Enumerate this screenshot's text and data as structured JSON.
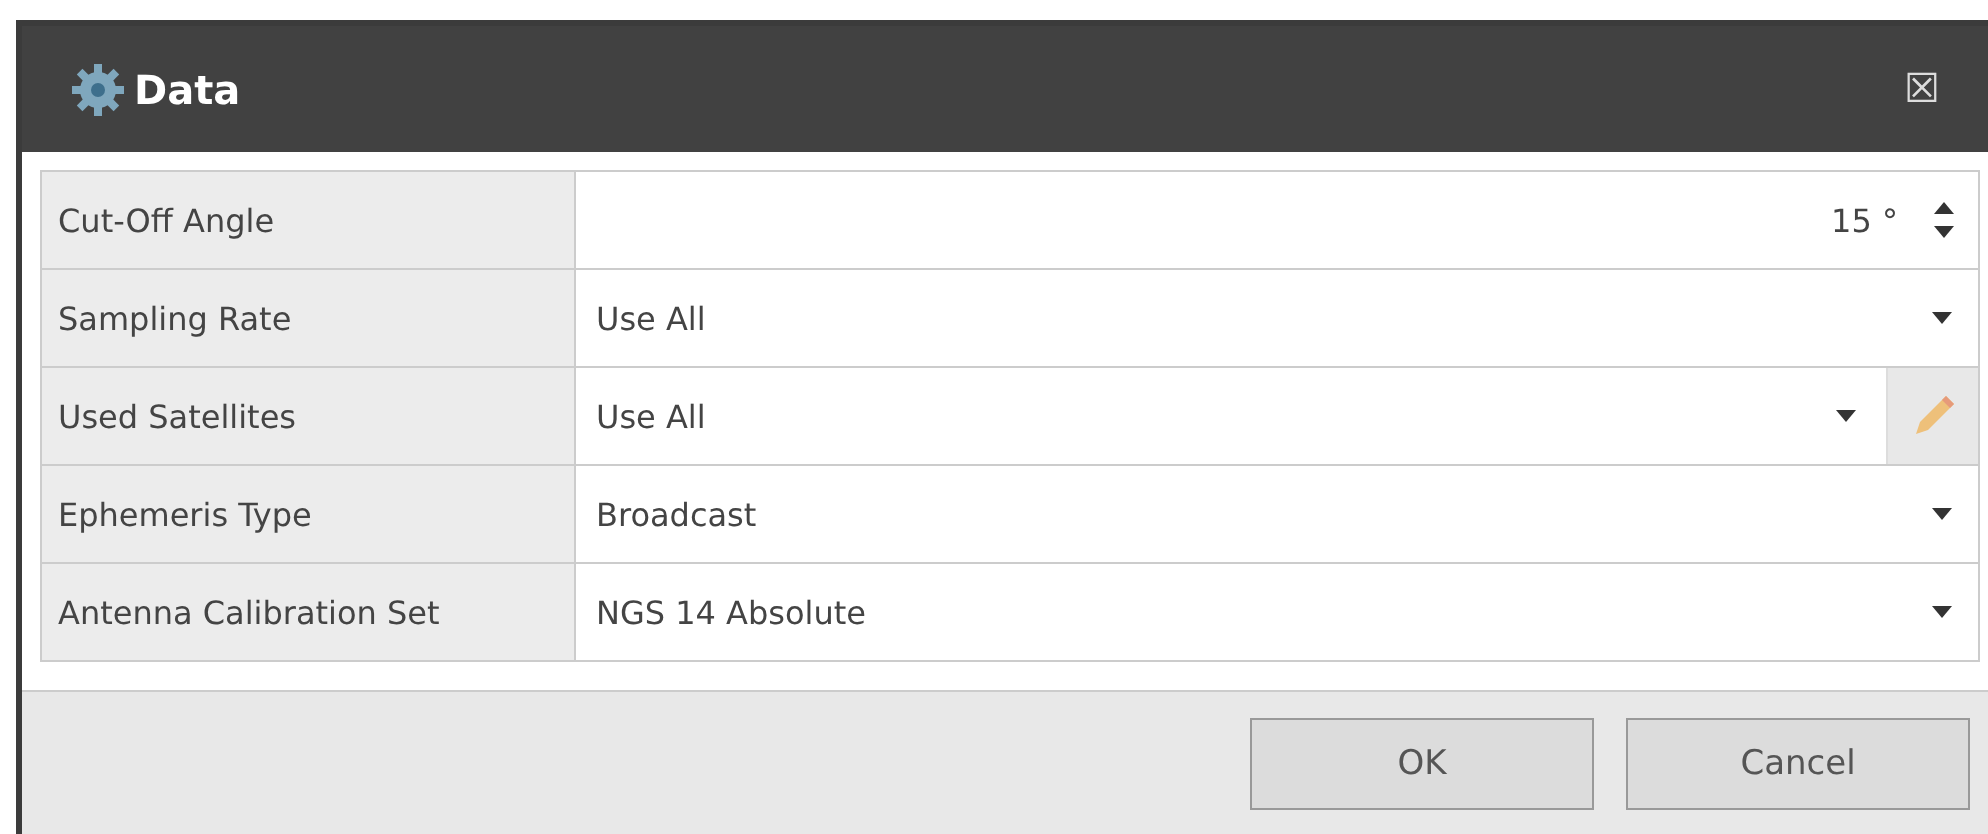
{
  "window": {
    "title": "Data",
    "close": "☒"
  },
  "properties": [
    {
      "label": "Cut-Off Angle",
      "kind": "spinner",
      "value": "15 °"
    },
    {
      "label": "Sampling Rate",
      "kind": "dropdown",
      "value": "Use All"
    },
    {
      "label": "Used Satellites",
      "kind": "dropdown-edit",
      "value": "Use All"
    },
    {
      "label": "Ephemeris Type",
      "kind": "dropdown",
      "value": "Broadcast"
    },
    {
      "label": "Antenna Calibration Set",
      "kind": "dropdown",
      "value": "NGS 14 Absolute"
    }
  ],
  "buttons": [
    "OK",
    "Cancel"
  ]
}
